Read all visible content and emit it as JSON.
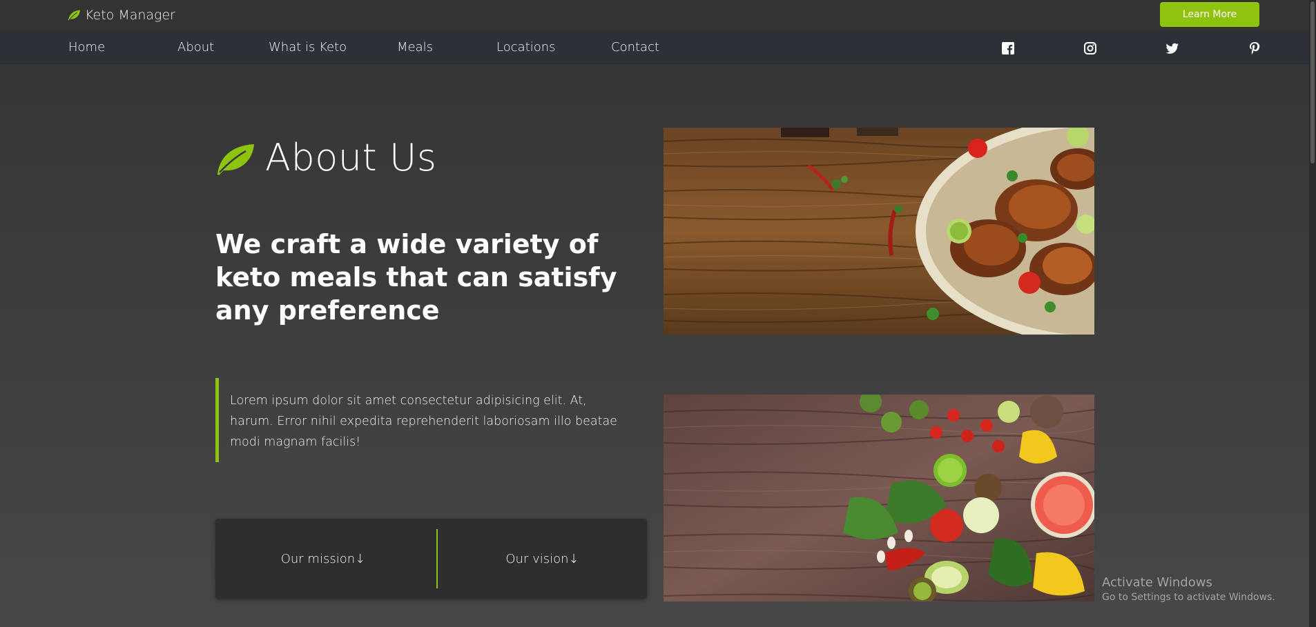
{
  "header": {
    "brand_name": "Keto Manager",
    "brand_icon": "leaf-icon",
    "cta_label": "Learn More"
  },
  "nav": {
    "items": [
      {
        "label": "Home"
      },
      {
        "label": "About"
      },
      {
        "label": "What is Keto"
      },
      {
        "label": "Meals"
      },
      {
        "label": "Locations"
      },
      {
        "label": "Contact"
      }
    ],
    "social": [
      "facebook-icon",
      "instagram-icon",
      "twitter-icon",
      "pinterest-icon"
    ]
  },
  "about": {
    "title": "About Us",
    "headline": "We craft a wide variety of keto meals that can satisfy any preference",
    "quote": "Lorem ipsum dolor sit amet consectetur adipisicing elit. At, harum. Error nihil expedita reprehenderit laboriosam illo beatae modi magnam facilis!",
    "mission_label": "Our mission",
    "vision_label": "Our vision",
    "arrow": "↓"
  },
  "images": {
    "first": "grilled-chicken-photo",
    "second": "vegetables-photo"
  },
  "system": {
    "activate_title": "Activate Windows",
    "activate_sub": "Go to Settings to activate Windows."
  },
  "colors": {
    "accent": "#8ec40f",
    "topbar": "#333333",
    "navbar": "#2c3137",
    "card": "#2e2e2e"
  }
}
